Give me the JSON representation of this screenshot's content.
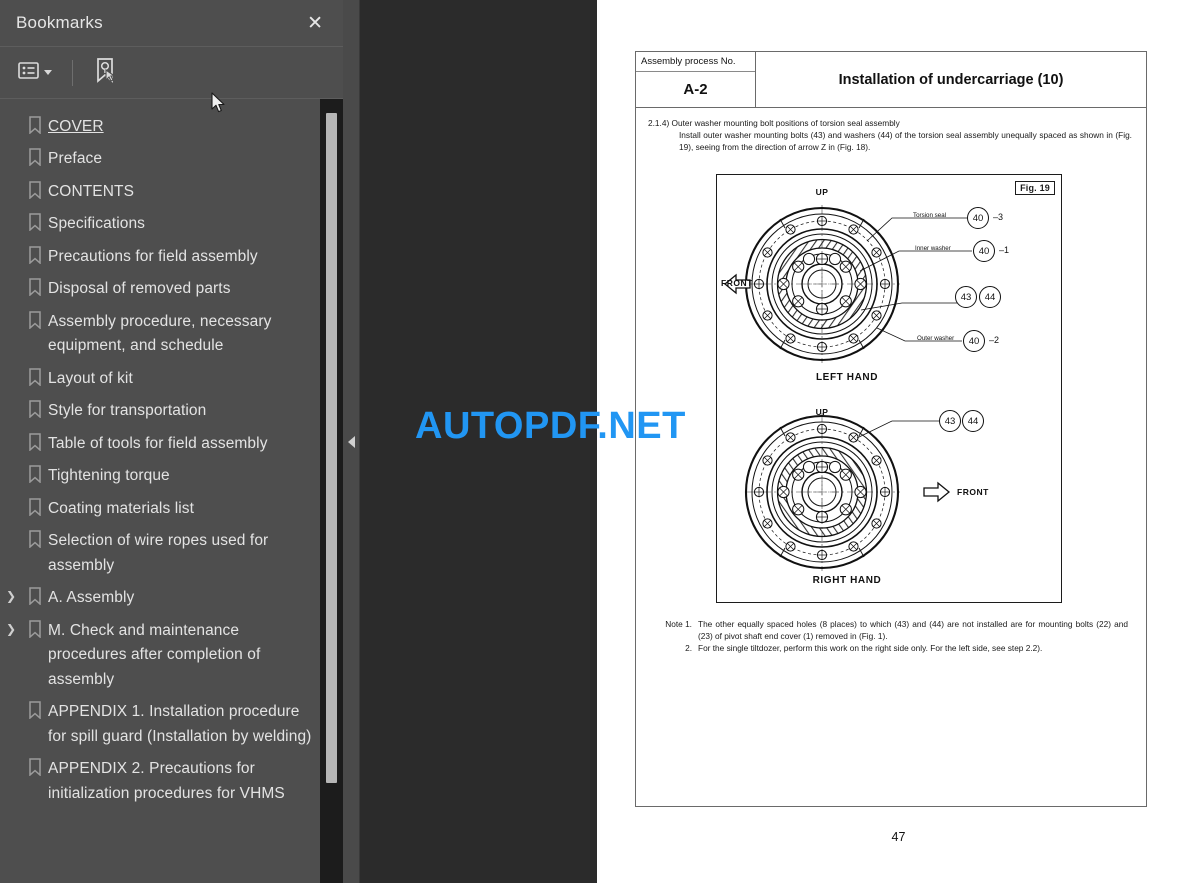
{
  "sidebar": {
    "title": "Bookmarks",
    "close_label": "✕",
    "toolbar": {
      "options_icon": "list-options-icon",
      "dropdown_icon": "chevron-down-icon",
      "new_bookmark_icon": "new-bookmark-icon"
    },
    "items": [
      {
        "label": "COVER",
        "expandable": false,
        "underline": true
      },
      {
        "label": "Preface",
        "expandable": false,
        "underline": false
      },
      {
        "label": "CONTENTS",
        "expandable": false,
        "underline": false
      },
      {
        "label": "Specifications",
        "expandable": false,
        "underline": false
      },
      {
        "label": "Precautions for field assembly",
        "expandable": false,
        "underline": false
      },
      {
        "label": "Disposal of removed parts",
        "expandable": false,
        "underline": false
      },
      {
        "label": "Assembly procedure, necessary equipment, and schedule",
        "expandable": false,
        "underline": false
      },
      {
        "label": "Layout of kit",
        "expandable": false,
        "underline": false
      },
      {
        "label": "Style for transportation",
        "expandable": false,
        "underline": false
      },
      {
        "label": "Table of tools for field assembly",
        "expandable": false,
        "underline": false
      },
      {
        "label": "Tightening torque",
        "expandable": false,
        "underline": false
      },
      {
        "label": "Coating materials list",
        "expandable": false,
        "underline": false
      },
      {
        "label": "Selection of wire ropes used for assembly",
        "expandable": false,
        "underline": false
      },
      {
        "label": "A. Assembly",
        "expandable": true,
        "underline": false
      },
      {
        "label": "M.  Check and maintenance procedures after completion of assembly",
        "expandable": true,
        "underline": false
      },
      {
        "label": "APPENDIX 1. Installation procedure for spill guard (Installation by welding)",
        "expandable": false,
        "underline": false
      },
      {
        "label": "APPENDIX 2. Precautions for initialization procedures for VHMS",
        "expandable": false,
        "underline": false
      }
    ],
    "collapse_arrow": "◀"
  },
  "watermark": {
    "text": "AUTOPDF.NET",
    "color": "#2196f3"
  },
  "document": {
    "header": {
      "process_no_label": "Assembly process No.",
      "process_no_value": "A-2",
      "title": "Installation of undercarriage (10)"
    },
    "body": {
      "step_lead": "2.1.4) Outer washer mounting bolt positions of torsion seal assembly",
      "step_text": "Install outer washer mounting bolts (43) and washers (44) of the torsion seal assembly unequally spaced as shown in (Fig. 19), seeing from the direction of arrow Z in (Fig. 18)."
    },
    "figure": {
      "tag": "Fig. 19",
      "top": {
        "caption": "LEFT HAND",
        "up_label": "UP",
        "front_label": "FRONT",
        "callouts": [
          {
            "text": "Torsion seal",
            "balloon": "40",
            "suffix": "–3"
          },
          {
            "text": "Inner washer",
            "balloon": "40",
            "suffix": "–1"
          },
          {
            "text": "Outer washer",
            "balloon": "40",
            "suffix": "–2"
          }
        ],
        "bolt_balloons": [
          "43",
          "44"
        ]
      },
      "bottom": {
        "caption": "RIGHT HAND",
        "up_label": "UP",
        "front_label": "FRONT",
        "bolt_balloons": [
          "43",
          "44"
        ]
      }
    },
    "notes": [
      {
        "label": "Note 1.",
        "text": "The other equally spaced holes (8 places) to which (43) and (44) are not installed are for mounting bolts (22) and (23) of pivot shaft end cover (1) removed in (Fig. 1)."
      },
      {
        "label": "2.",
        "text": "For the single tiltdozer, perform this work on the right side only. For the left side, see step 2.2)."
      }
    ],
    "page_number": "47"
  }
}
